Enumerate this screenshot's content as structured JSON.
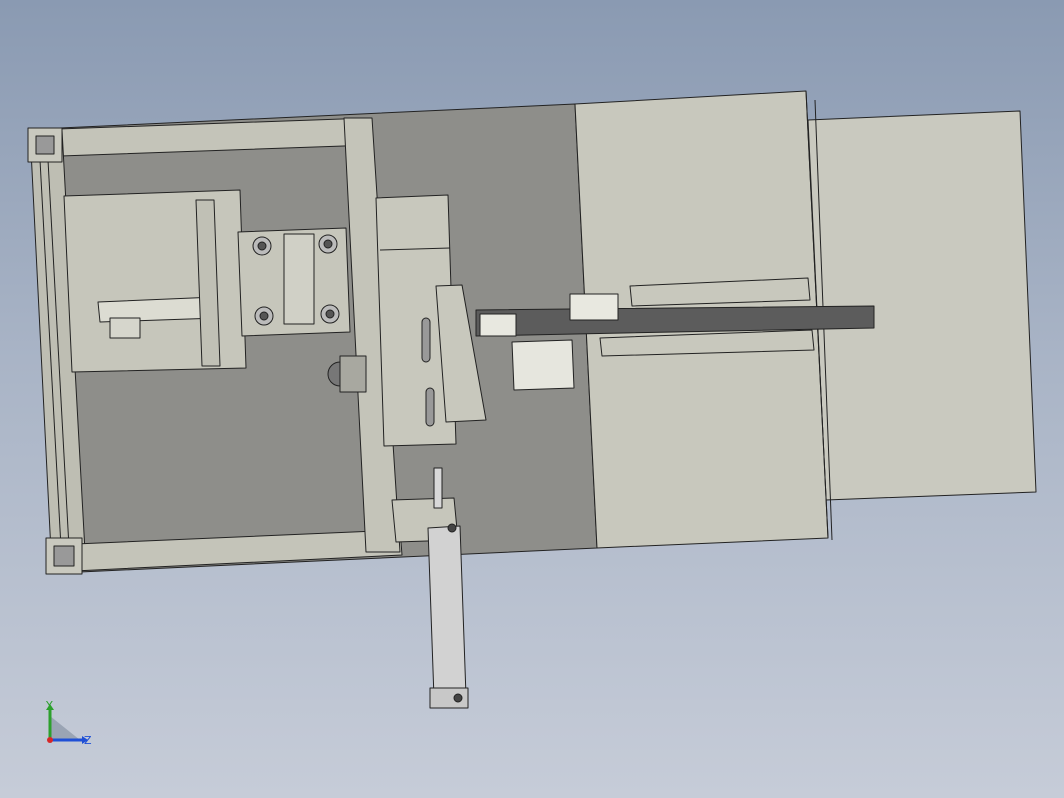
{
  "viewport": {
    "background_top": "#8a9ab2",
    "background_bottom": "#c6ccd8"
  },
  "model": {
    "part_fill_light": "#c8c8bd",
    "part_fill_mid": "#bdbdb2",
    "part_fill_dark": "#8f8f8b",
    "edge_color": "#222222"
  },
  "triad": {
    "y_label": "Y",
    "z_label": "Z",
    "y_color": "#2ca02c",
    "z_color": "#1f4fd6",
    "x_color": "#d62728"
  }
}
